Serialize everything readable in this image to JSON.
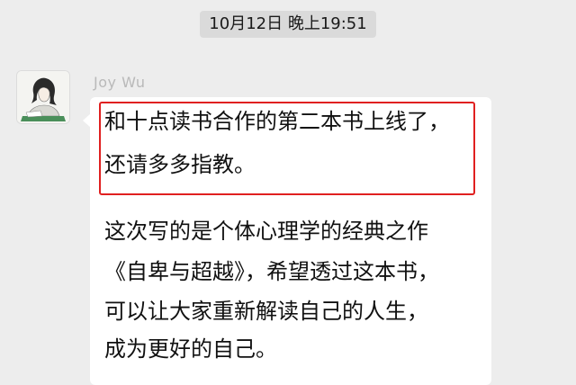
{
  "chat": {
    "timestamp": "10月12日 晚上19:51",
    "sender": {
      "name": "Joy Wu",
      "avatar_icon": "avatar-sketch-icon"
    },
    "message": {
      "highlighted_lines": [
        "和十点读书合作的第二本书上线了，",
        "还请多多指教。"
      ],
      "body_lines": [
        "这次写的是个体心理学的经典之作",
        "《自卑与超越》，希望透过这本书，",
        "可以让大家重新解读自己的人生，",
        "成为更好的自己。"
      ]
    },
    "colors": {
      "background": "#ededed",
      "bubble": "#ffffff",
      "highlight_border": "#e02020",
      "timestamp_bg": "#dadada"
    }
  }
}
